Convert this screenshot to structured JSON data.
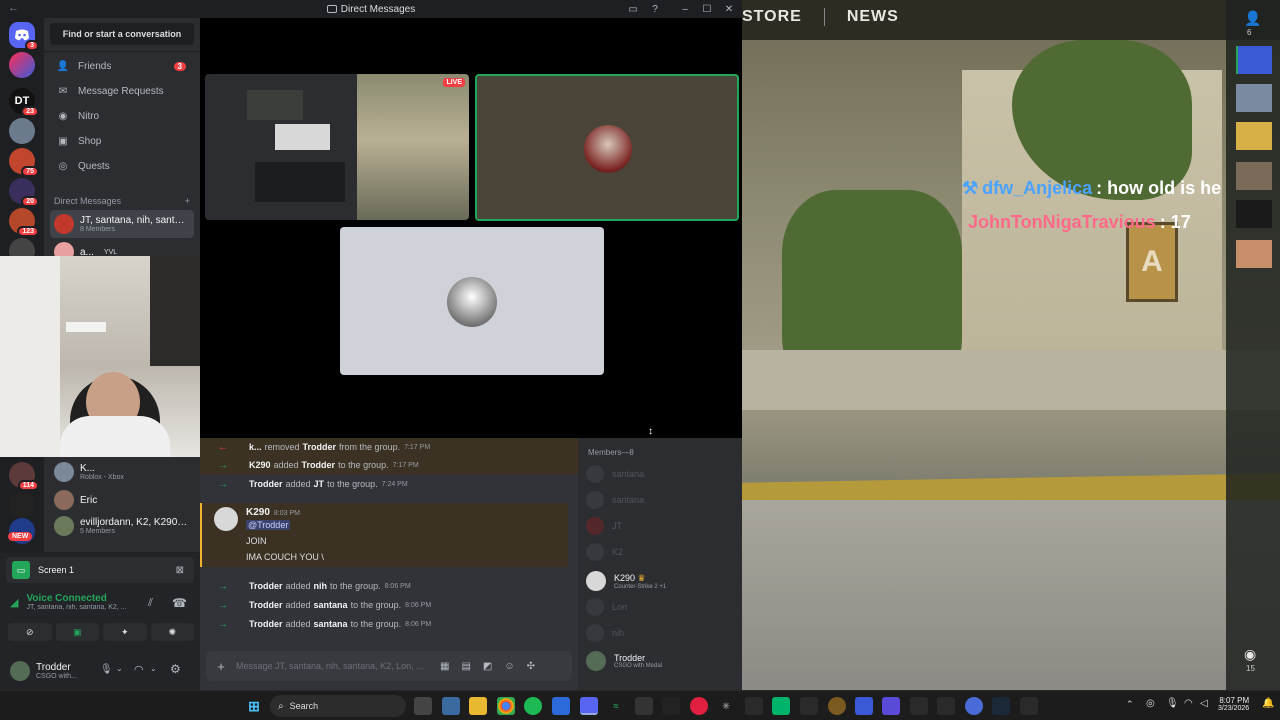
{
  "window": {
    "title": "Direct Messages"
  },
  "rail": {
    "badges": [
      "3",
      "23",
      "75",
      "20",
      "123",
      "114",
      "NEW"
    ],
    "logo_text": "DT"
  },
  "sidebar": {
    "search_placeholder": "Find or start a conversation",
    "nav": [
      {
        "label": "Friends",
        "badge": "3",
        "icon": "friends-icon"
      },
      {
        "label": "Message Requests",
        "icon": "mail-icon"
      },
      {
        "label": "Nitro",
        "icon": "nitro-icon"
      },
      {
        "label": "Shop",
        "icon": "shop-icon"
      },
      {
        "label": "Quests",
        "icon": "quests-icon"
      }
    ],
    "dm_header": "Direct Messages",
    "dms": [
      {
        "name": "JT, santana, nih, santan...",
        "sub": "8 Members"
      },
      {
        "name": "a...",
        "sub": "YVL"
      },
      {
        "name": "K...",
        "sub": "Roblox - Xbox"
      },
      {
        "name": "Eric",
        "sub": ""
      },
      {
        "name": "evilljordann, K2, K290, ...",
        "sub": "5 Members"
      }
    ]
  },
  "voice_panel": {
    "screen_label": "Screen 1",
    "status": "Voice Connected",
    "channel": "JT, santana, nih, santana, K2, ...",
    "user_name": "Trodder",
    "user_status": "CSGO with..."
  },
  "call": {
    "live_badge": "LIVE"
  },
  "chat": {
    "messages": [
      {
        "type": "system",
        "actor": "k...",
        "action": "removed",
        "target": "Trodder",
        "suffix": "from the group.",
        "time": "7:17 PM"
      },
      {
        "type": "system",
        "actor": "K290",
        "action": "added",
        "target": "Trodder",
        "suffix": "to the group.",
        "time": "7:17 PM"
      },
      {
        "type": "system",
        "actor": "Trodder",
        "action": "added",
        "target": "JT",
        "suffix": "to the group.",
        "time": "7:24 PM"
      }
    ],
    "post": {
      "author": "K290",
      "time": "8:03 PM",
      "mention": "@Trodder",
      "lines": [
        "JOIN",
        "IMA COUCH YOU \\"
      ]
    },
    "messages2": [
      {
        "actor": "Trodder",
        "action": "added",
        "target": "nih",
        "suffix": "to the group.",
        "time": "8:06 PM"
      },
      {
        "actor": "Trodder",
        "action": "added",
        "target": "santana",
        "suffix": "to the group.",
        "time": "8:06 PM"
      },
      {
        "actor": "Trodder",
        "action": "added",
        "target": "santana",
        "suffix": "to the group.",
        "time": "8:06 PM"
      }
    ],
    "input_placeholder": "Message JT, santana, nih, santana, K2, Lon, ..."
  },
  "members": {
    "header": "Members—8",
    "list": [
      {
        "name": "santana",
        "sub": "",
        "online": false
      },
      {
        "name": "santana",
        "sub": "",
        "online": false
      },
      {
        "name": "JT",
        "sub": "",
        "online": false
      },
      {
        "name": "K2",
        "sub": "",
        "online": false
      },
      {
        "name": "K290",
        "sub": "Counter-Strike 2 +1",
        "online": true
      },
      {
        "name": "Lon",
        "sub": "",
        "online": false
      },
      {
        "name": "nih",
        "sub": "",
        "online": false
      },
      {
        "name": "Trodder",
        "sub": "CSGO with Medal",
        "online": true
      }
    ]
  },
  "game": {
    "menu": [
      "STORE",
      "NEWS"
    ],
    "friend_count": "6",
    "chat_lines": [
      {
        "user": "dfw_Anjelica",
        "text": ": how old is he"
      },
      {
        "user": "JohnTonNigaTravious",
        "text": ": 17"
      }
    ],
    "sign_letter": "A",
    "broadcast_count": "15"
  },
  "taskbar": {
    "search_label": "Search",
    "clock_time": "8:07 PM",
    "clock_date": "3/23/2026"
  },
  "colors": {
    "blurple": "#5865f2",
    "green": "#23a55a",
    "red": "#f23f43"
  }
}
